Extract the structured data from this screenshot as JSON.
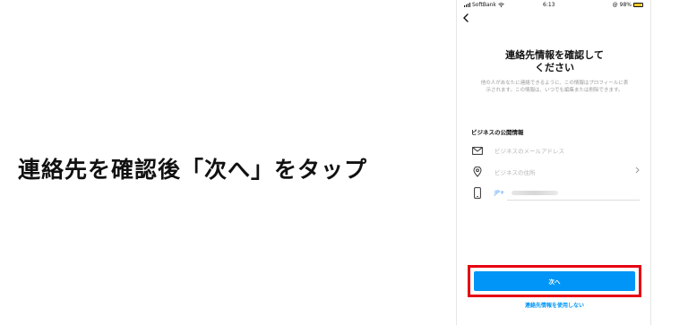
{
  "caption": "連絡先を確認後「次へ」をタップ",
  "status_bar": {
    "carrier": "SoftBank",
    "time": "6:13",
    "battery": "98%"
  },
  "screen": {
    "title_line1": "連絡先情報を確認して",
    "title_line2": "ください",
    "description": "他の人があなたに連絡できるように、この情報はプロフィールに表示されます。この情報は、いつでも編集または削除できます。",
    "section_label": "ビジネスの公開情報",
    "email_placeholder": "ビジネスのメールアドレス",
    "address_placeholder": "ビジネスの住所",
    "phone_country": "JP+",
    "next_button": "次へ",
    "skip_link": "連絡先情報を使用しない"
  },
  "colors": {
    "accent": "#0095f6",
    "highlight": "#e60012"
  }
}
